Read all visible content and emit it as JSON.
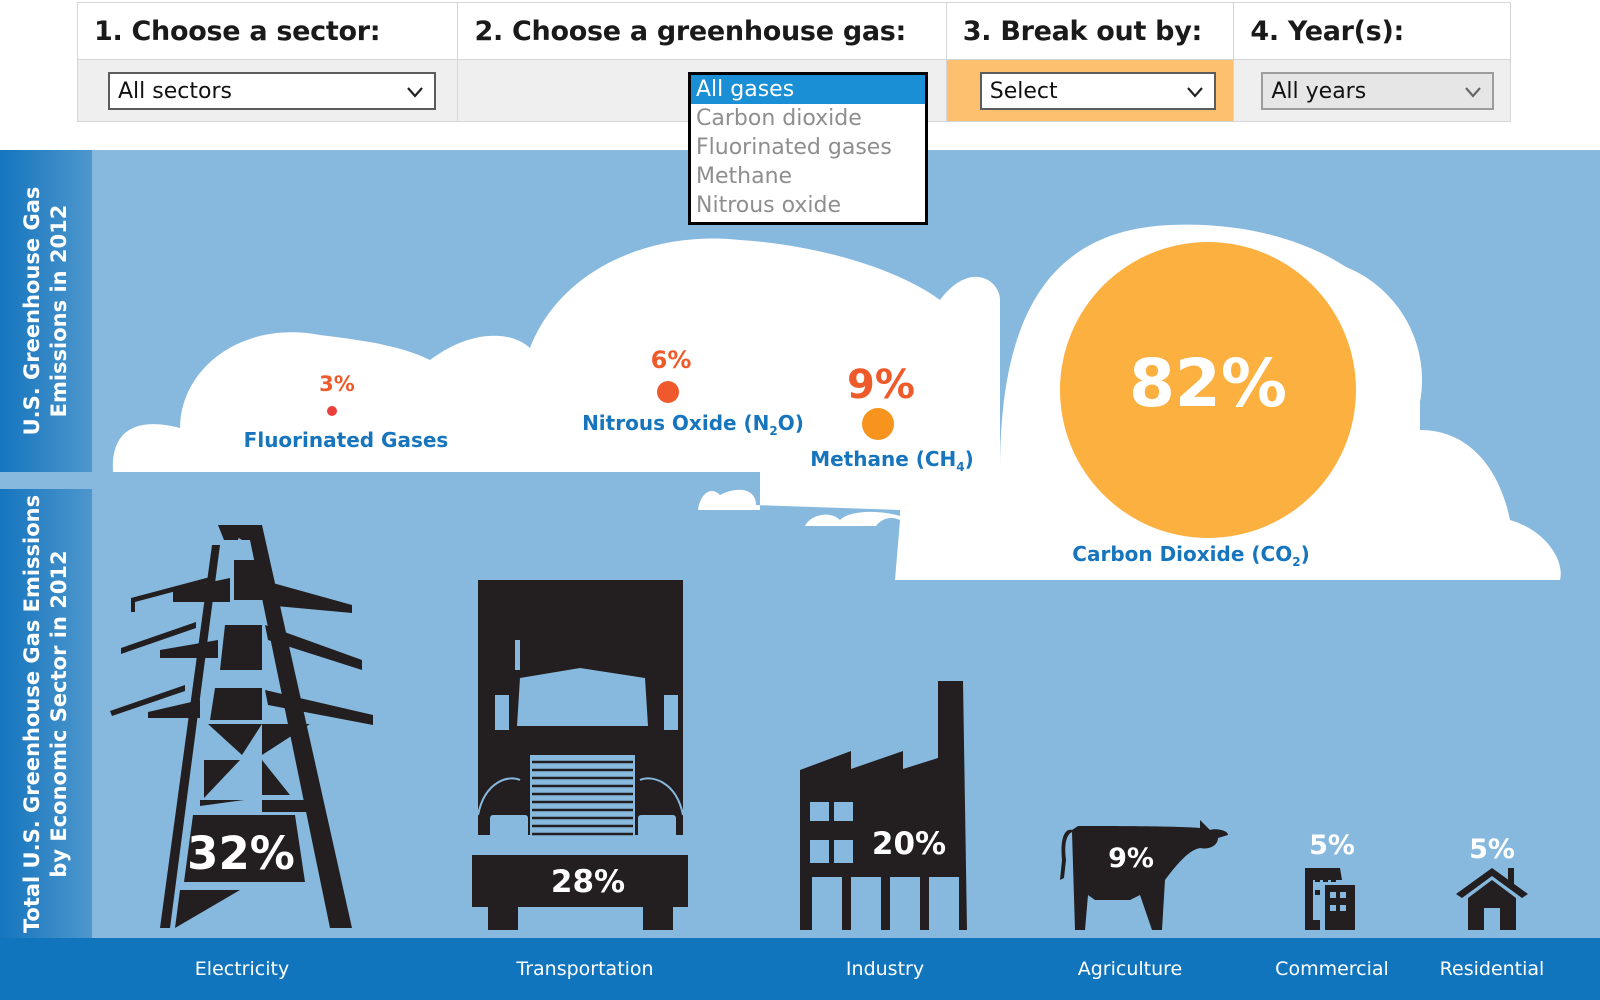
{
  "filters": {
    "sector": {
      "heading": "1. Choose a sector:",
      "value": "All sectors"
    },
    "gas": {
      "heading": "2. Choose a greenhouse gas:",
      "options": [
        "All gases",
        "Carbon dioxide",
        "Fluorinated gases",
        "Methane",
        "Nitrous oxide"
      ],
      "selected": "All gases"
    },
    "breakout": {
      "heading": "3. Break out by:",
      "value": "Select",
      "highlight_color": "#fcc06e"
    },
    "years": {
      "heading": "4. Year(s):",
      "value": "All years"
    }
  },
  "sidebar": {
    "gases_title_line1": "U.S. Greenhouse Gas",
    "gases_title_line2": "Emissions in 2012",
    "sectors_title_line1": "Total U.S. Greenhouse Gas Emissions",
    "sectors_title_line2": "by Economic Sector in 2012"
  },
  "chart_data": [
    {
      "type": "bubble",
      "title": "U.S. Greenhouse Gas Emissions in 2012",
      "categories": [
        "Fluorinated Gases",
        "Nitrous Oxide (N2O)",
        "Methane (CH4)",
        "Carbon Dioxide (CO2)"
      ],
      "values": [
        3,
        6,
        9,
        82
      ],
      "unit": "%"
    },
    {
      "type": "pictogram",
      "title": "Total U.S. Greenhouse Gas Emissions by Economic Sector in 2012",
      "categories": [
        "Electricity",
        "Transportation",
        "Industry",
        "Agriculture",
        "Commercial",
        "Residential"
      ],
      "values": [
        32,
        28,
        20,
        9,
        5,
        5
      ],
      "unit": "%"
    }
  ],
  "gases": [
    {
      "pct": "3%",
      "name": "Fluorinated Gases",
      "sub": "",
      "tail": "",
      "color": "#e9403a"
    },
    {
      "pct": "6%",
      "name": "Nitrous Oxide (N",
      "sub": "2",
      "tail": "O)",
      "color": "#f0592b"
    },
    {
      "pct": "9%",
      "name": "Methane (CH",
      "sub": "4",
      "tail": ")",
      "color": "#f7941e"
    },
    {
      "pct": "82%",
      "name": "Carbon Dioxide (CO",
      "sub": "2",
      "tail": ")",
      "color": "#fbb040"
    }
  ],
  "sectors": [
    {
      "pct": "32%",
      "name": "Electricity"
    },
    {
      "pct": "28%",
      "name": "Transportation"
    },
    {
      "pct": "20%",
      "name": "Industry"
    },
    {
      "pct": "9%",
      "name": "Agriculture"
    },
    {
      "pct": "5%",
      "name": "Commercial"
    },
    {
      "pct": "5%",
      "name": "Residential"
    }
  ]
}
